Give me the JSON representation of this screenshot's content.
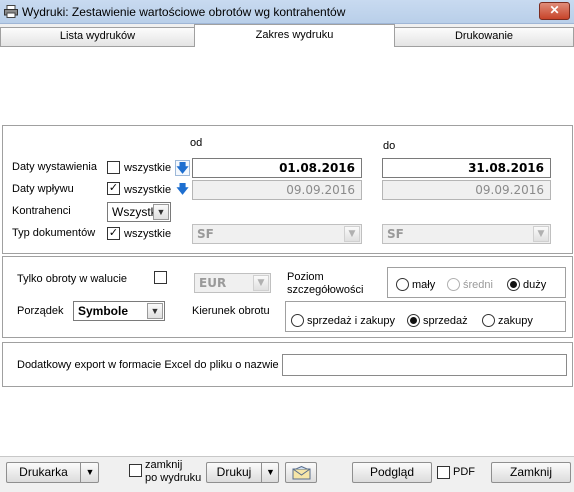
{
  "window": {
    "title": "Wydruki: Zestawienie wartościowe obrotów wg kontrahentów",
    "close_glyph": "✕"
  },
  "tabs": [
    {
      "label": "Lista wydruków",
      "active": false
    },
    {
      "label": "Zakres wydruku",
      "active": true
    },
    {
      "label": "Drukowanie",
      "active": false
    }
  ],
  "dates": {
    "from_header": "od",
    "to_header": "do",
    "issue": {
      "label": "Daty wystawienia",
      "all_label": "wszystkie",
      "all_checked": false,
      "from": "01.08.2016",
      "to": "31.08.2016"
    },
    "receipt": {
      "label": "Daty wpływu",
      "all_label": "wszystkie",
      "all_checked": true,
      "from": "09.09.2016",
      "to": "09.09.2016"
    }
  },
  "contractors": {
    "label": "Kontrahenci",
    "value": "Wszystk"
  },
  "doc_types": {
    "label": "Typ dokumentów",
    "all_label": "wszystkie",
    "all_checked": true,
    "from": "SF",
    "to": "SF"
  },
  "options": {
    "currency_only_label": "Tylko obroty w walucie",
    "currency_only_checked": false,
    "currency": "EUR",
    "order_label": "Porządek",
    "order_value": "Symbole",
    "detail_label_line1": "Poziom",
    "detail_label_line2": "szczegółowości",
    "detail_options": [
      {
        "label": "mały",
        "checked": false,
        "disabled": false
      },
      {
        "label": "średni",
        "checked": false,
        "disabled": true
      },
      {
        "label": "duży",
        "checked": true,
        "disabled": false
      }
    ],
    "direction_label": "Kierunek obrotu",
    "direction_options": [
      {
        "label": "sprzedaż i zakupy",
        "checked": false
      },
      {
        "label": "sprzedaż",
        "checked": true
      },
      {
        "label": "zakupy",
        "checked": false
      }
    ]
  },
  "export": {
    "label": "Dodatkowy export w formacie Excel do pliku o nazwie",
    "value": ""
  },
  "footer": {
    "printer_label": "Drukarka",
    "close_after_line1": "zamknij",
    "close_after_line2": "po wydruku",
    "close_after_checked": false,
    "print_label": "Drukuj",
    "preview_label": "Podgląd",
    "pdf_label": "PDF",
    "pdf_checked": false,
    "close_label": "Zamknij",
    "dropdown_glyph": "▼"
  },
  "icons": {
    "app": "printer-icon",
    "date_arrow": "down-arrow-icon",
    "email": "envelope-icon",
    "check_glyph": "✓"
  }
}
